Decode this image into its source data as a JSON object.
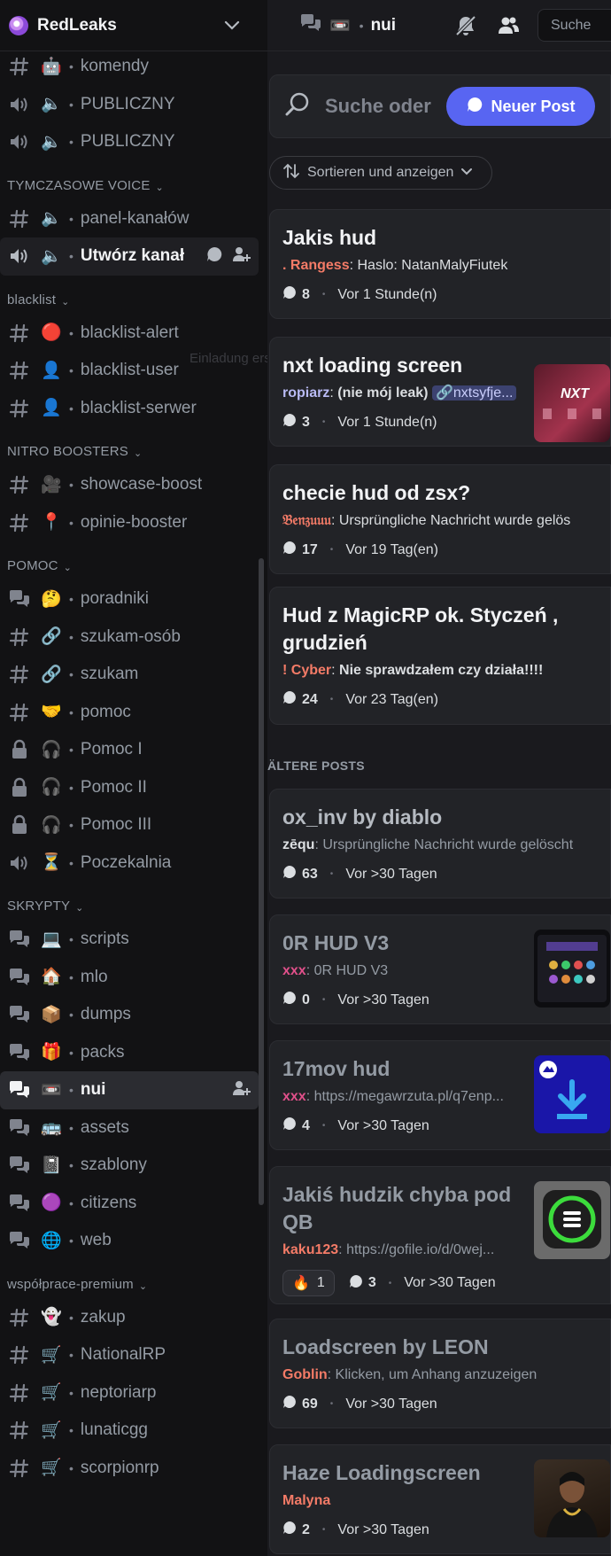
{
  "server": {
    "name": "RedLeaks"
  },
  "channels": [
    {
      "kind": "text",
      "emoji": "🤖",
      "name": "komendy"
    },
    {
      "kind": "voice",
      "emoji": "🔈",
      "name": "PUBLICZNY"
    },
    {
      "kind": "voice",
      "emoji": "🔈",
      "name": "PUBLICZNY"
    },
    {
      "kind": "category",
      "name": "TYMCZASOWE VOICE"
    },
    {
      "kind": "text",
      "emoji": "🔈",
      "name": "panel-kanałów"
    },
    {
      "kind": "voice",
      "emoji": "🔈",
      "name": "Utwórz kanał",
      "state": "hover"
    },
    {
      "kind": "category",
      "name": "blacklist"
    },
    {
      "kind": "text",
      "emoji": "🔴",
      "name": "blacklist-alert"
    },
    {
      "kind": "text",
      "emoji": "👤",
      "name": "blacklist-user"
    },
    {
      "kind": "text",
      "emoji": "👤",
      "name": "blacklist-serwer"
    },
    {
      "kind": "category",
      "name": "NITRO BOOSTERS"
    },
    {
      "kind": "text",
      "emoji": "🎥",
      "name": "showcase-boost"
    },
    {
      "kind": "text",
      "emoji": "📍",
      "name": "opinie-booster"
    },
    {
      "kind": "category",
      "name": "POMOC"
    },
    {
      "kind": "forum",
      "emoji": "🤔",
      "name": "poradniki"
    },
    {
      "kind": "text",
      "emoji": "🔗",
      "name": "szukam-osób"
    },
    {
      "kind": "text",
      "emoji": "🔗",
      "name": "szukam"
    },
    {
      "kind": "text",
      "emoji": "🤝",
      "name": "pomoc"
    },
    {
      "kind": "locked",
      "emoji": "🎧",
      "name": "Pomoc I"
    },
    {
      "kind": "locked",
      "emoji": "🎧",
      "name": "Pomoc II"
    },
    {
      "kind": "locked",
      "emoji": "🎧",
      "name": "Pomoc III"
    },
    {
      "kind": "voice",
      "emoji": "⏳",
      "name": "Poczekalnia"
    },
    {
      "kind": "category",
      "name": "SKRYPTY"
    },
    {
      "kind": "forum",
      "emoji": "💻",
      "name": "scripts"
    },
    {
      "kind": "forum",
      "emoji": "🏠",
      "name": "mlo"
    },
    {
      "kind": "forum",
      "emoji": "📦",
      "name": "dumps"
    },
    {
      "kind": "forum",
      "emoji": "🎁",
      "name": "packs"
    },
    {
      "kind": "forum",
      "emoji": "📼",
      "name": "nui",
      "state": "active"
    },
    {
      "kind": "forum",
      "emoji": "🚌",
      "name": "assets"
    },
    {
      "kind": "forum",
      "emoji": "📓",
      "name": "szablony"
    },
    {
      "kind": "forum",
      "emoji": "🟣",
      "name": "citizens"
    },
    {
      "kind": "forum",
      "emoji": "🌐",
      "name": "web"
    },
    {
      "kind": "category",
      "name": "współprace-premium"
    },
    {
      "kind": "text",
      "emoji": "👻",
      "name": "zakup"
    },
    {
      "kind": "text",
      "emoji": "🛒",
      "name": "NationalRP"
    },
    {
      "kind": "text",
      "emoji": "🛒",
      "name": "neptoriarp"
    },
    {
      "kind": "text",
      "emoji": "🛒",
      "name": "lunaticgg"
    },
    {
      "kind": "text",
      "emoji": "🛒",
      "name": "scorpionrp"
    }
  ],
  "ghost_text": "Einladung erste",
  "topbar": {
    "channel_emoji": "📼",
    "channel_name": "nui",
    "search_placeholder": "Suche"
  },
  "forum": {
    "search_placeholder": "Suche oder",
    "new_post_label": "Neuer Post",
    "sort_label": "Sortieren und anzeigen",
    "older_label": "ÄLTERE POSTS",
    "posts": [
      {
        "title": "Jakis hud",
        "author": ". Rangess",
        "author_color": "#f47b67",
        "preview": "Haslo: NatanMalyFiutek",
        "count": "8",
        "time": "Vor 1 Stunde(n)"
      },
      {
        "title": "nxt loading screen",
        "author": "ropiarz",
        "author_color": "#b9bbf4",
        "preview": "(nie mój leak)",
        "link": "nxtsyfje...",
        "count": "3",
        "time": "Vor 1 Stunde(n)",
        "thumb": "nxt"
      },
      {
        "title": "checie hud od zsx?",
        "author": "𝔅𝔢𝔫𝔷𝔲𝔲𝔲",
        "author_color": "#f47b67",
        "preview": "Ursprüngliche Nachricht wurde gelös",
        "count": "17",
        "time": "Vor 19 Tag(en)"
      },
      {
        "title": "Hud z MagicRP ok. Styczeń ,",
        "title2": "grudzień",
        "author": "! Cyber",
        "author_color": "#f47b67",
        "preview": "Nie sprawdzałem czy działa!!!!",
        "count": "24",
        "time": "Vor 23 Tag(en)"
      },
      {
        "title": "ox_inv by diablo",
        "author": "zēqu",
        "author_color": "#dbdee1",
        "preview": "Ursprüngliche Nachricht wurde gelöscht",
        "count": "63",
        "time": "Vor >30 Tagen"
      },
      {
        "title": "0R HUD V3",
        "author": "xxx",
        "author_color": "#e0508a",
        "preview": "0R HUD V3",
        "count": "0",
        "time": "Vor >30 Tagen",
        "thumb": "hud"
      },
      {
        "title": "17mov hud",
        "author": "xxx",
        "author_color": "#e0508a",
        "preview": "https://megawrzuta.pl/q7enp...",
        "count": "4",
        "time": "Vor >30 Tagen",
        "thumb": "download"
      },
      {
        "title": "Jakiś hudzik chyba pod",
        "title2": "QB",
        "author": "kaku123",
        "author_color": "#f47b67",
        "preview": "https://gofile.io/d/0wej...",
        "reaction_emoji": "🔥",
        "reaction_count": "1",
        "count": "3",
        "time": "Vor >30 Tagen",
        "thumb": "ring"
      },
      {
        "title": "Loadscreen by LEON",
        "author": "Goblin",
        "author_color": "#f47b67",
        "preview": "Klicken, um Anhang anzuzeigen",
        "count": "69",
        "time": "Vor >30 Tagen"
      },
      {
        "title": "Haze Loadingscreen",
        "author": "Malyna",
        "author_color": "#f47b67",
        "preview": "",
        "count": "2",
        "time": "Vor >30 Tagen",
        "thumb": "person"
      }
    ]
  },
  "colors": {
    "accent": "#5865f2",
    "sidebar": "#121214",
    "panel": "#222327"
  }
}
